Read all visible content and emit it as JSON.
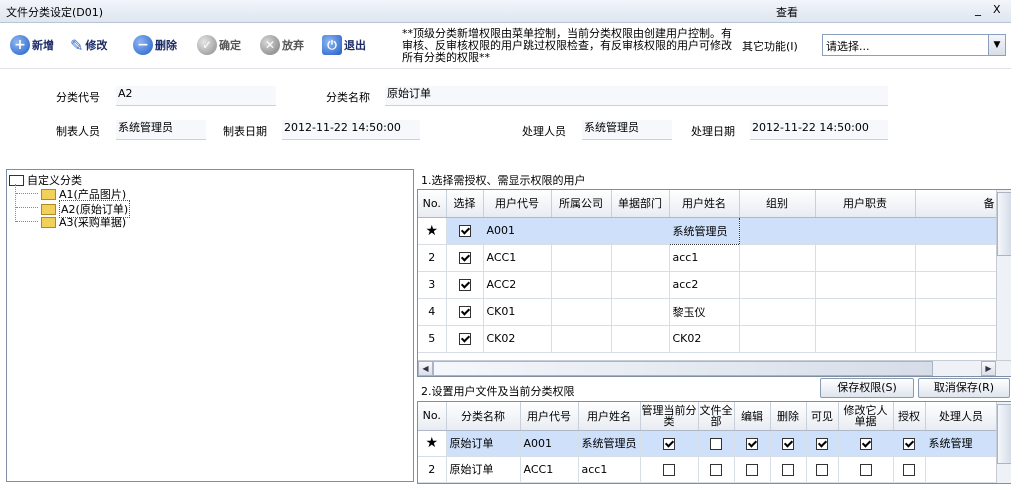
{
  "window": {
    "title": "文件分类设定(D01)",
    "view_label": "查看",
    "minimize": "_",
    "close": "X"
  },
  "toolbar": {
    "add": "新增",
    "edit": "修改",
    "delete": "删除",
    "confirm": "确定",
    "discard": "放弃",
    "exit": "退出"
  },
  "notice": "**顶级分类新增权限由菜单控制，当前分类权限由创建用户控制。有审核、反审核权限的用户跳过权限检查，有反审核权限的用户可修改所有分类的权限**",
  "other_functions": {
    "label": "其它功能(I)",
    "selected": "请选择..."
  },
  "form": {
    "category_code_label": "分类代号",
    "category_code": "A2",
    "category_name_label": "分类名称",
    "category_name": "原始订单",
    "creator_label": "制表人员",
    "creator": "系统管理员",
    "created_date_label": "制表日期",
    "created_date": "2012-11-22 14:50:00",
    "handler_label": "处理人员",
    "handler": "系统管理员",
    "handled_date_label": "处理日期",
    "handled_date": "2012-11-22 14:50:00"
  },
  "tree": {
    "root": "自定义分类",
    "children": [
      "A1(产品图片)",
      "A2(原始订单)",
      "A3(采购单据)"
    ]
  },
  "users_section": {
    "title": "1.选择需授权、需显示权限的用户",
    "columns": [
      "No.",
      "选择",
      "用户代号",
      "所属公司",
      "单据部门",
      "用户姓名",
      "组别",
      "用户职责",
      "备"
    ],
    "rows": [
      {
        "no": "★",
        "checked": true,
        "code": "A001",
        "company": "",
        "dept": "",
        "name": "系统管理员",
        "group": "",
        "duty": ""
      },
      {
        "no": "2",
        "checked": true,
        "code": "ACC1",
        "company": "",
        "dept": "",
        "name": "acc1",
        "group": "",
        "duty": ""
      },
      {
        "no": "3",
        "checked": true,
        "code": "ACC2",
        "company": "",
        "dept": "",
        "name": "acc2",
        "group": "",
        "duty": ""
      },
      {
        "no": "4",
        "checked": true,
        "code": "CK01",
        "company": "",
        "dept": "",
        "name": "黎玉仪",
        "group": "",
        "duty": ""
      },
      {
        "no": "5",
        "checked": true,
        "code": "CK02",
        "company": "",
        "dept": "",
        "name": "CK02",
        "group": "",
        "duty": ""
      }
    ]
  },
  "perm_section": {
    "title": "2.设置用户文件及当前分类权限",
    "save_button": "保存权限(S)",
    "cancel_button": "取消保存(R)",
    "columns": [
      "No.",
      "分类名称",
      "用户代号",
      "用户姓名",
      "管理当前分类",
      "文件全部",
      "编辑",
      "删除",
      "可见",
      "修改它人单据",
      "授权",
      "处理人员"
    ],
    "rows": [
      {
        "no": "★",
        "category": "原始订单",
        "code": "A001",
        "name": "系统管理员",
        "manage": true,
        "all": false,
        "edit": true,
        "del": true,
        "visible": true,
        "modify_others": true,
        "grant": true,
        "handler": "系统管理"
      },
      {
        "no": "2",
        "category": "原始订单",
        "code": "ACC1",
        "name": "acc1",
        "manage": false,
        "all": false,
        "edit": false,
        "del": false,
        "visible": false,
        "modify_others": false,
        "grant": false,
        "handler": ""
      }
    ]
  }
}
